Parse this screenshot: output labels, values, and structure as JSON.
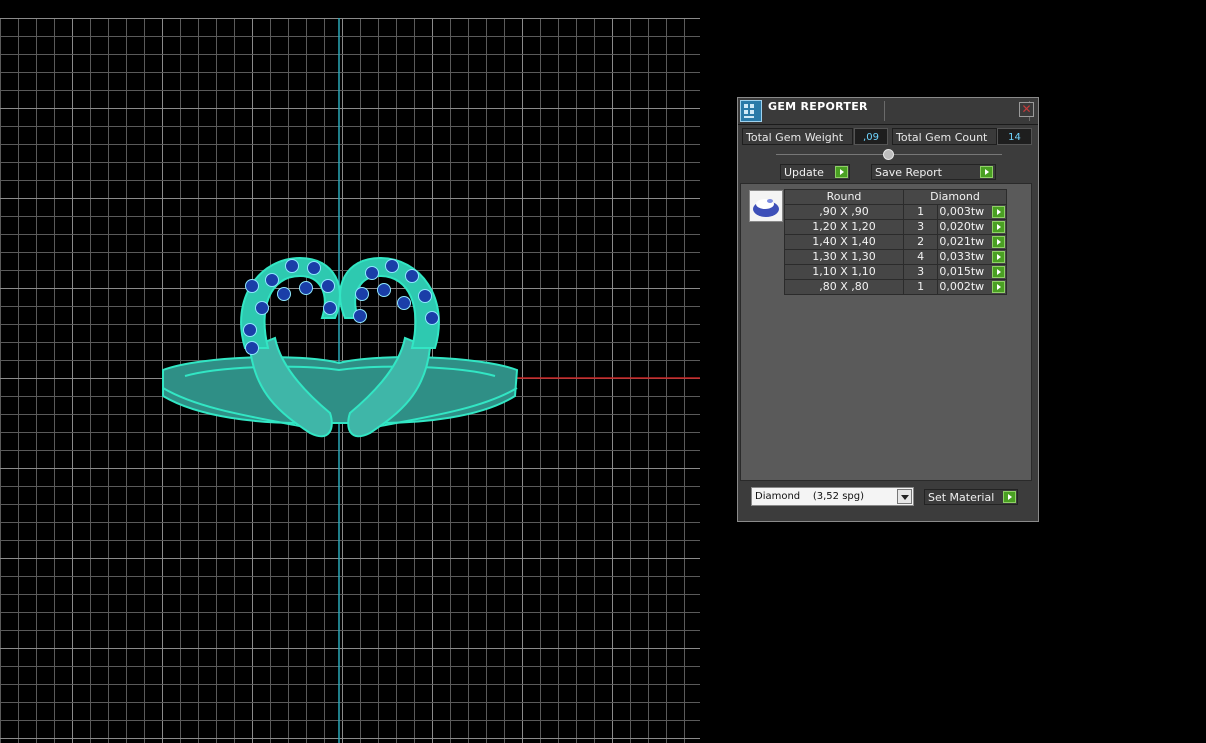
{
  "panel": {
    "title": "GEM REPORTER",
    "total_gem_weight_label": "Total Gem Weight",
    "total_gem_weight_value": ",09",
    "total_gem_count_label": "Total Gem Count",
    "total_gem_count_value": "14",
    "update_label": "Update",
    "save_report_label": "Save Report",
    "set_material_label": "Set Material",
    "material_selected": "Diamond    (3,52 spg)"
  },
  "table": {
    "headers": [
      "Round",
      "Diamond"
    ],
    "rows": [
      {
        "size": ",90 X ,90",
        "count": "1",
        "weight": "0,003tw"
      },
      {
        "size": "1,20 X 1,20",
        "count": "3",
        "weight": "0,020tw"
      },
      {
        "size": "1,40 X 1,40",
        "count": "2",
        "weight": "0,021tw"
      },
      {
        "size": "1,30 X 1,30",
        "count": "4",
        "weight": "0,033tw"
      },
      {
        "size": "1,10 X 1,10",
        "count": "3",
        "weight": "0,015tw"
      },
      {
        "size": ",80 X ,80",
        "count": "1",
        "weight": "0,002tw"
      }
    ]
  },
  "colors": {
    "background": "#000000",
    "grid": "#5a5a5a",
    "axis_vertical": "#2aa7b8",
    "axis_horizontal": "#c62020",
    "ring": "#32e6c4",
    "gems": "#1a3ea8",
    "value_text": "#6fd5ff",
    "go_button": "#4aa023"
  }
}
